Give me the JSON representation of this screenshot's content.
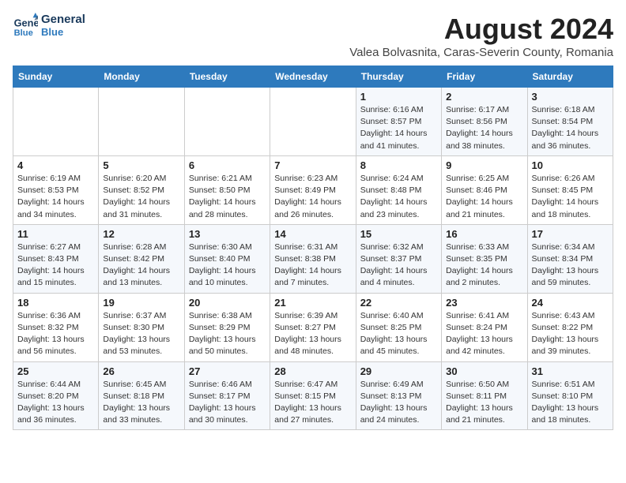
{
  "header": {
    "logo_line1": "General",
    "logo_line2": "Blue",
    "main_title": "August 2024",
    "subtitle": "Valea Bolvasnita, Caras-Severin County, Romania"
  },
  "days_of_week": [
    "Sunday",
    "Monday",
    "Tuesday",
    "Wednesday",
    "Thursday",
    "Friday",
    "Saturday"
  ],
  "weeks": [
    [
      {
        "day": "",
        "info": ""
      },
      {
        "day": "",
        "info": ""
      },
      {
        "day": "",
        "info": ""
      },
      {
        "day": "",
        "info": ""
      },
      {
        "day": "1",
        "info": "Sunrise: 6:16 AM\nSunset: 8:57 PM\nDaylight: 14 hours and 41 minutes."
      },
      {
        "day": "2",
        "info": "Sunrise: 6:17 AM\nSunset: 8:56 PM\nDaylight: 14 hours and 38 minutes."
      },
      {
        "day": "3",
        "info": "Sunrise: 6:18 AM\nSunset: 8:54 PM\nDaylight: 14 hours and 36 minutes."
      }
    ],
    [
      {
        "day": "4",
        "info": "Sunrise: 6:19 AM\nSunset: 8:53 PM\nDaylight: 14 hours and 34 minutes."
      },
      {
        "day": "5",
        "info": "Sunrise: 6:20 AM\nSunset: 8:52 PM\nDaylight: 14 hours and 31 minutes."
      },
      {
        "day": "6",
        "info": "Sunrise: 6:21 AM\nSunset: 8:50 PM\nDaylight: 14 hours and 28 minutes."
      },
      {
        "day": "7",
        "info": "Sunrise: 6:23 AM\nSunset: 8:49 PM\nDaylight: 14 hours and 26 minutes."
      },
      {
        "day": "8",
        "info": "Sunrise: 6:24 AM\nSunset: 8:48 PM\nDaylight: 14 hours and 23 minutes."
      },
      {
        "day": "9",
        "info": "Sunrise: 6:25 AM\nSunset: 8:46 PM\nDaylight: 14 hours and 21 minutes."
      },
      {
        "day": "10",
        "info": "Sunrise: 6:26 AM\nSunset: 8:45 PM\nDaylight: 14 hours and 18 minutes."
      }
    ],
    [
      {
        "day": "11",
        "info": "Sunrise: 6:27 AM\nSunset: 8:43 PM\nDaylight: 14 hours and 15 minutes."
      },
      {
        "day": "12",
        "info": "Sunrise: 6:28 AM\nSunset: 8:42 PM\nDaylight: 14 hours and 13 minutes."
      },
      {
        "day": "13",
        "info": "Sunrise: 6:30 AM\nSunset: 8:40 PM\nDaylight: 14 hours and 10 minutes."
      },
      {
        "day": "14",
        "info": "Sunrise: 6:31 AM\nSunset: 8:38 PM\nDaylight: 14 hours and 7 minutes."
      },
      {
        "day": "15",
        "info": "Sunrise: 6:32 AM\nSunset: 8:37 PM\nDaylight: 14 hours and 4 minutes."
      },
      {
        "day": "16",
        "info": "Sunrise: 6:33 AM\nSunset: 8:35 PM\nDaylight: 14 hours and 2 minutes."
      },
      {
        "day": "17",
        "info": "Sunrise: 6:34 AM\nSunset: 8:34 PM\nDaylight: 13 hours and 59 minutes."
      }
    ],
    [
      {
        "day": "18",
        "info": "Sunrise: 6:36 AM\nSunset: 8:32 PM\nDaylight: 13 hours and 56 minutes."
      },
      {
        "day": "19",
        "info": "Sunrise: 6:37 AM\nSunset: 8:30 PM\nDaylight: 13 hours and 53 minutes."
      },
      {
        "day": "20",
        "info": "Sunrise: 6:38 AM\nSunset: 8:29 PM\nDaylight: 13 hours and 50 minutes."
      },
      {
        "day": "21",
        "info": "Sunrise: 6:39 AM\nSunset: 8:27 PM\nDaylight: 13 hours and 48 minutes."
      },
      {
        "day": "22",
        "info": "Sunrise: 6:40 AM\nSunset: 8:25 PM\nDaylight: 13 hours and 45 minutes."
      },
      {
        "day": "23",
        "info": "Sunrise: 6:41 AM\nSunset: 8:24 PM\nDaylight: 13 hours and 42 minutes."
      },
      {
        "day": "24",
        "info": "Sunrise: 6:43 AM\nSunset: 8:22 PM\nDaylight: 13 hours and 39 minutes."
      }
    ],
    [
      {
        "day": "25",
        "info": "Sunrise: 6:44 AM\nSunset: 8:20 PM\nDaylight: 13 hours and 36 minutes."
      },
      {
        "day": "26",
        "info": "Sunrise: 6:45 AM\nSunset: 8:18 PM\nDaylight: 13 hours and 33 minutes."
      },
      {
        "day": "27",
        "info": "Sunrise: 6:46 AM\nSunset: 8:17 PM\nDaylight: 13 hours and 30 minutes."
      },
      {
        "day": "28",
        "info": "Sunrise: 6:47 AM\nSunset: 8:15 PM\nDaylight: 13 hours and 27 minutes."
      },
      {
        "day": "29",
        "info": "Sunrise: 6:49 AM\nSunset: 8:13 PM\nDaylight: 13 hours and 24 minutes."
      },
      {
        "day": "30",
        "info": "Sunrise: 6:50 AM\nSunset: 8:11 PM\nDaylight: 13 hours and 21 minutes."
      },
      {
        "day": "31",
        "info": "Sunrise: 6:51 AM\nSunset: 8:10 PM\nDaylight: 13 hours and 18 minutes."
      }
    ]
  ]
}
